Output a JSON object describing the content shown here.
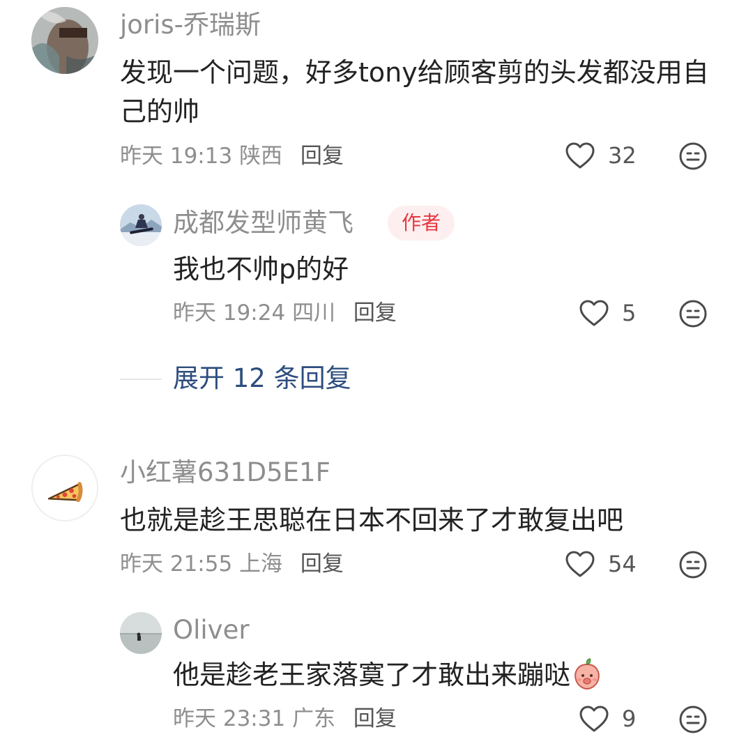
{
  "comments": [
    {
      "username": "joris-乔瑞斯",
      "text": "发现一个问题，好多tony给顾客剪的头发都没用自己的帅",
      "time": "昨天 19:13",
      "location": "陕西",
      "reply_label": "回复",
      "likes": "32",
      "avatar_icon": "portrait-avatar",
      "replies": [
        {
          "username": "成都发型师黄飞",
          "badge": "作者",
          "text": "我也不帅p的好",
          "time": "昨天 19:24",
          "location": "四川",
          "reply_label": "回复",
          "likes": "5",
          "avatar_icon": "snowboarder-avatar"
        }
      ],
      "expand_label": "展开 12 条回复"
    },
    {
      "username": "小红薯631D5E1F",
      "text": "也就是趁王思聪在日本不回来了才敢复出吧",
      "time": "昨天 21:55",
      "location": "上海",
      "reply_label": "回复",
      "likes": "54",
      "avatar_icon": "pizza-avatar",
      "replies": [
        {
          "username": "Oliver",
          "text": "他是趁老王家落寞了才敢出来蹦哒",
          "inline_emoji": "peach-emoji",
          "time": "昨天 23:31",
          "location": "广东",
          "reply_label": "回复",
          "likes": "9",
          "avatar_icon": "seaside-avatar"
        }
      ]
    }
  ],
  "colors": {
    "username": "#8e8e8e",
    "text": "#222222",
    "meta": "#8e8e8e",
    "link": "#2d4d7e",
    "badge_bg": "#fdeff0",
    "badge_text": "#e8373f"
  }
}
